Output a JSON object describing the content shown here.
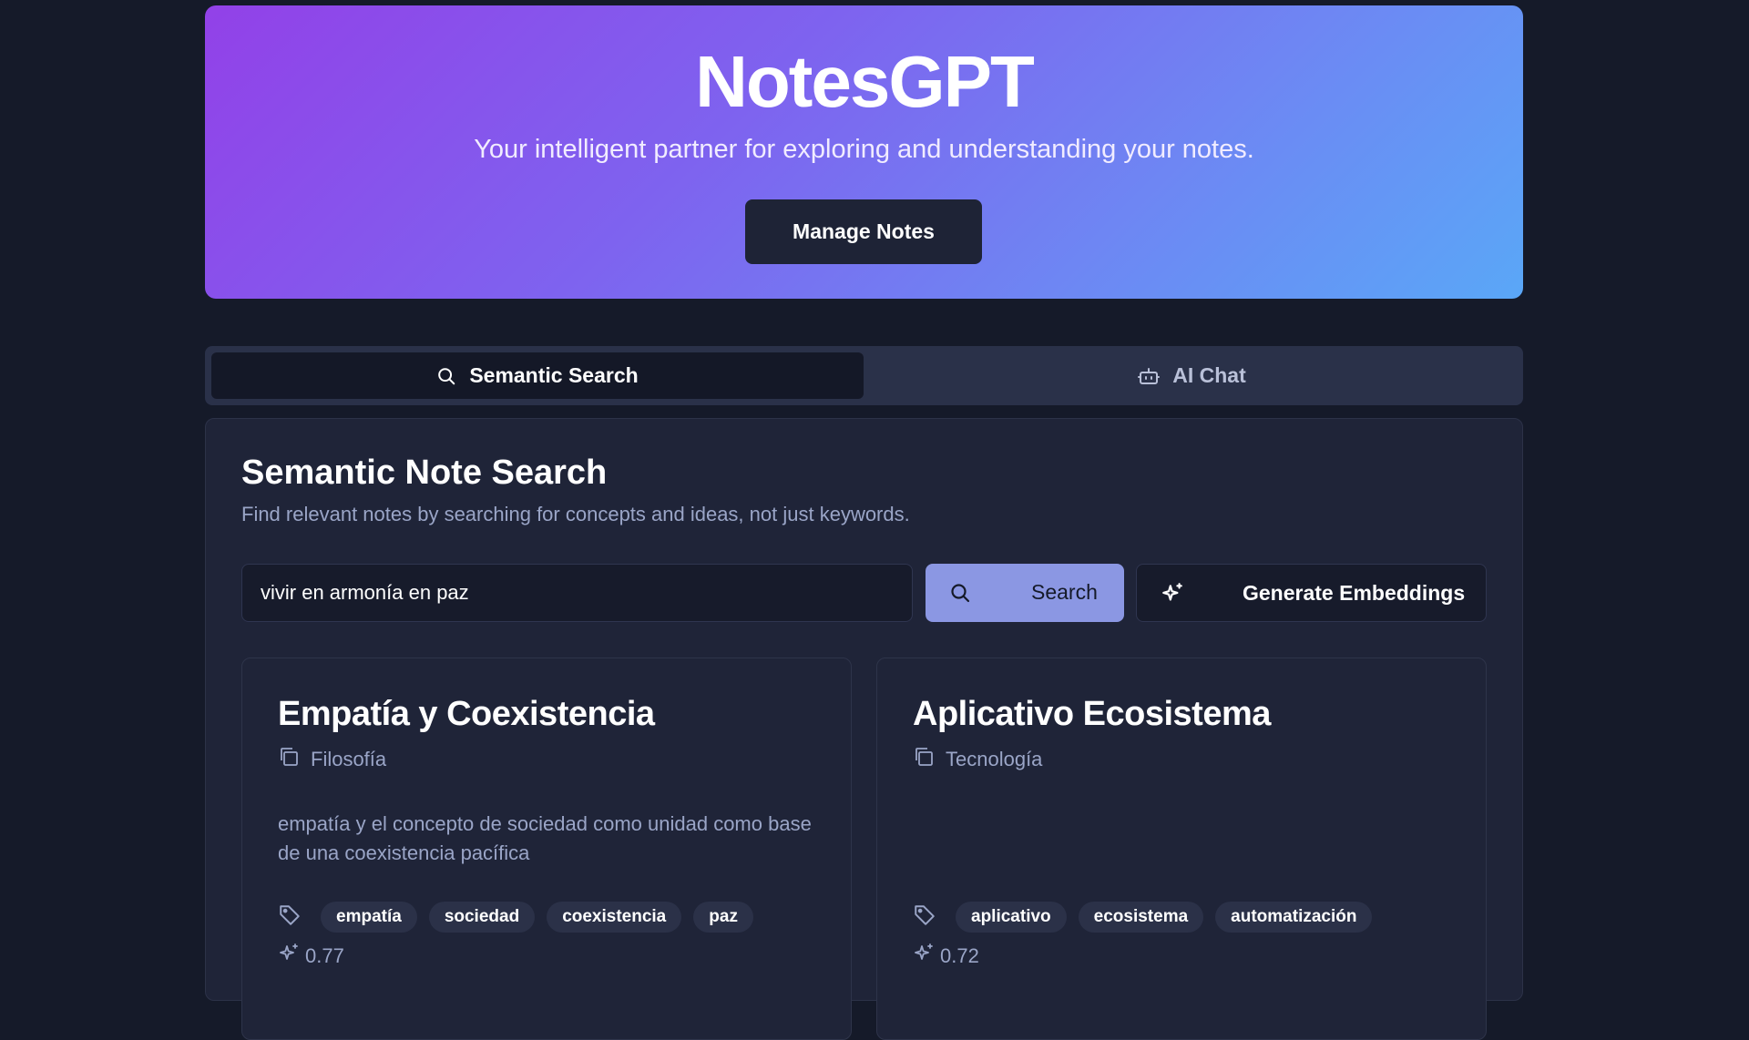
{
  "hero": {
    "title": "NotesGPT",
    "subtitle": "Your intelligent partner for exploring and understanding your notes.",
    "manage_button": "Manage Notes"
  },
  "tabs": [
    {
      "label": "Semantic Search",
      "icon": "search-icon",
      "active": true
    },
    {
      "label": "AI Chat",
      "icon": "bot-icon",
      "active": false
    }
  ],
  "search_panel": {
    "title": "Semantic Note Search",
    "description": "Find relevant notes by searching for concepts and ideas, not just keywords.",
    "query_value": "vivir en armonía en paz",
    "search_button": "Search",
    "generate_button": "Generate Embeddings"
  },
  "results": [
    {
      "title": "Empatía y Coexistencia",
      "category": "Filosofía",
      "body": "empatía y el concepto de sociedad como unidad como base de una coexistencia pacífica",
      "tags": [
        "empatía",
        "sociedad",
        "coexistencia",
        "paz"
      ],
      "score": "0.77"
    },
    {
      "title": "Aplicativo Ecosistema",
      "category": "Tecnología",
      "body": "",
      "tags": [
        "aplicativo",
        "ecosistema",
        "automatización"
      ],
      "score": "0.72"
    }
  ],
  "colors": {
    "background": "#151a29",
    "hero_gradient_start": "#9241e8",
    "hero_gradient_end": "#5aa7f7",
    "search_button": "#8b97e3",
    "panel": "#1f2438"
  }
}
